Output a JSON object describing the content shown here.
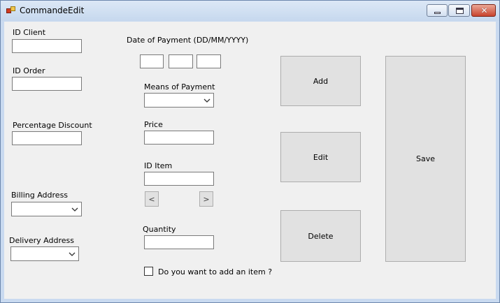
{
  "window": {
    "title": "CommandeEdit",
    "close_glyph": "✕"
  },
  "labels": {
    "id_client": "ID Client",
    "id_order": "ID Order",
    "percentage_discount": "Percentage Discount",
    "billing_address": "Billing Address",
    "delivery_address": "Delivery Address",
    "date_of_payment": "Date of Payment (DD/MM/YYYY)",
    "means_of_payment": "Means of Payment",
    "price": "Price",
    "id_item": "ID Item",
    "quantity": "Quantity",
    "add_item_check": "Do you want to add an item ?"
  },
  "fields": {
    "id_client": "",
    "id_order": "",
    "percentage_discount": "",
    "date_day": "",
    "date_month": "",
    "date_year": "",
    "price": "",
    "id_item": "",
    "quantity": "",
    "means_of_payment": "",
    "billing_address": "",
    "delivery_address": ""
  },
  "buttons": {
    "add": "Add",
    "edit": "Edit",
    "delete": "Delete",
    "save": "Save",
    "prev": "<",
    "next": ">"
  },
  "checkbox": {
    "add_item_checked": false
  },
  "icons": {
    "app": "app-icon",
    "minimize": "minimize-icon",
    "maximize": "maximize-icon",
    "close": "close-icon",
    "dropdown": "chevron-down-icon"
  }
}
